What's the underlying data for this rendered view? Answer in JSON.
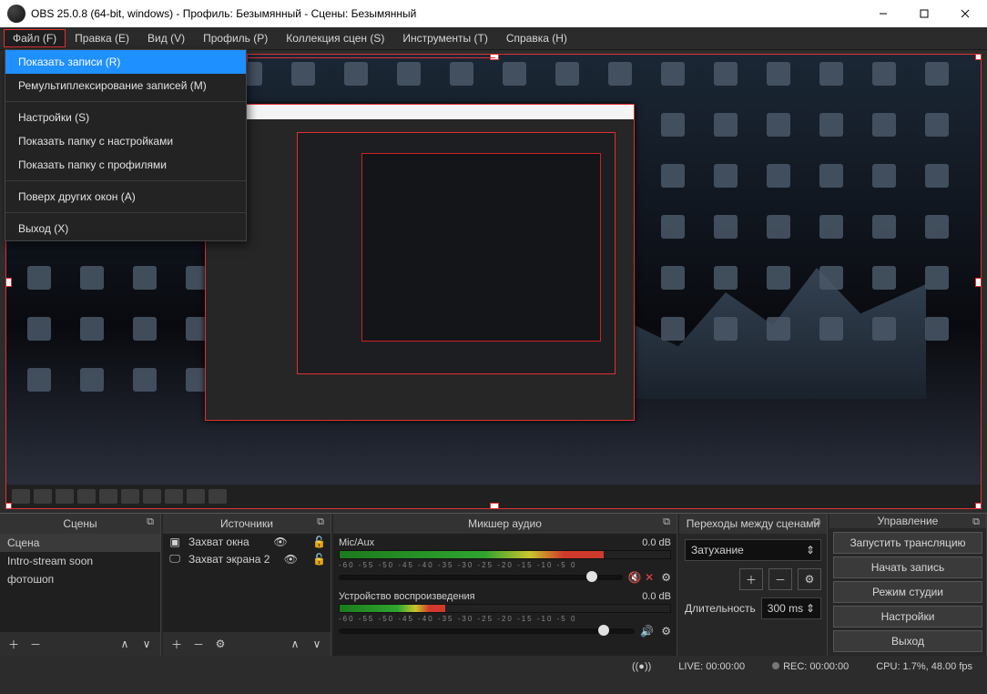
{
  "window": {
    "title": "OBS 25.0.8 (64-bit, windows) - Профиль: Безымянный - Сцены: Безымянный"
  },
  "menubar": {
    "file": "Файл (F)",
    "edit": "Правка (E)",
    "view": "Вид (V)",
    "profile": "Профиль (P)",
    "scenes": "Коллекция сцен (S)",
    "tools": "Инструменты (T)",
    "help": "Справка (H)"
  },
  "file_menu": {
    "show_recordings": "Показать записи (R)",
    "remux": "Ремультиплексирование записей (M)",
    "settings": "Настройки (S)",
    "show_settings_folder": "Показать папку с настройками",
    "show_profiles_folder": "Показать папку с профилями",
    "always_on_top": "Поверх других окон (A)",
    "exit": "Выход (X)"
  },
  "docks": {
    "scenes_title": "Сцены",
    "sources_title": "Источники",
    "mixer_title": "Микшер аудио",
    "transitions_title": "Переходы между сценами",
    "controls_title": "Управление"
  },
  "scenes": {
    "items": [
      "Сцена",
      "Intro-stream soon",
      "фотошоп"
    ]
  },
  "sources": {
    "items": [
      {
        "icon": "window",
        "name": "Захват окна"
      },
      {
        "icon": "monitor",
        "name": "Захват экрана 2"
      }
    ]
  },
  "mixer": {
    "ch1": {
      "name": "Mic/Aux",
      "db": "0.0 dB"
    },
    "ch2": {
      "name": "Устройство воспроизведения",
      "db": "0.0 dB"
    },
    "scale": "-60  -55  -50  -45  -40  -35  -30  -25  -20  -15  -10  -5   0"
  },
  "transitions": {
    "type": "Затухание",
    "duration_label": "Длительность",
    "duration_value": "300 ms"
  },
  "controls": {
    "start_stream": "Запустить трансляцию",
    "start_record": "Начать запись",
    "studio_mode": "Режим студии",
    "settings": "Настройки",
    "exit": "Выход"
  },
  "status": {
    "live": "LIVE: 00:00:00",
    "rec": "REC: 00:00:00",
    "cpu": "CPU: 1.7%, 48.00 fps"
  }
}
